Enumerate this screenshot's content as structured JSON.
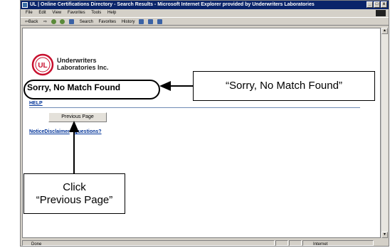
{
  "window": {
    "title": "UL | Online Certifications Directory - Search Results - Microsoft Internet Explorer provided by Underwriters Laboratories",
    "buttons": {
      "minimize": "_",
      "maximize": "□",
      "close": "x"
    }
  },
  "menubar": {
    "items": [
      "File",
      "Edit",
      "View",
      "Favorites",
      "Tools",
      "Help"
    ]
  },
  "toolbar": {
    "back": "⇦Back",
    "forward": "⇨",
    "search": "Search",
    "favorites": "Favorites",
    "history": "History"
  },
  "page": {
    "org_line1": "Underwriters",
    "org_line2": "Laboratories Inc.",
    "logo_text": "UL",
    "heading": "Sorry, No Match Found",
    "help": "HELP",
    "previous_button": "Previous Page",
    "notice": "Notice",
    "disclaimer": "Disclaimer",
    "separator": " - ",
    "questions": "Questions?"
  },
  "statusbar": {
    "left": "Done",
    "zone": "Internet"
  },
  "callouts": {
    "top": "“Sorry, No Match Found”",
    "bottom_line1": "Click",
    "bottom_line2": "“Previous Page”"
  },
  "colors": {
    "titlebar": "#0a246a",
    "link": "#003399",
    "logo_red": "#c8102e"
  }
}
